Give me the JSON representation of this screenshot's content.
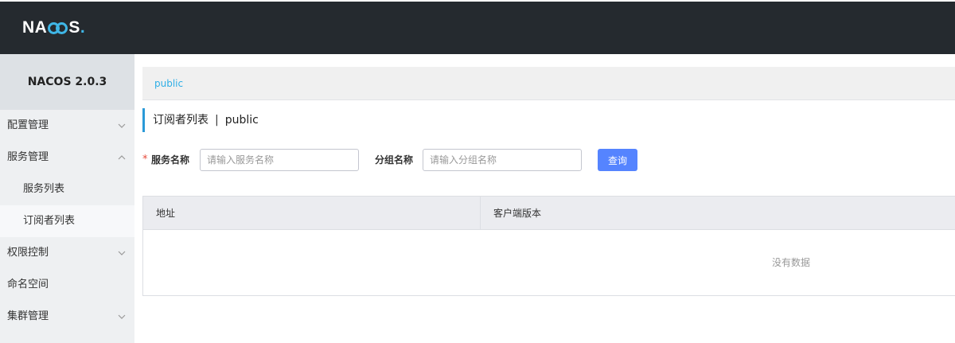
{
  "brand": {
    "logo_text_left": "NA",
    "logo_text_right": "S",
    "logo_dot": ".",
    "logo_full": "NACOS."
  },
  "sidebar": {
    "title": "NACOS 2.0.3",
    "items": [
      {
        "label": "配置管理",
        "expanded": false
      },
      {
        "label": "服务管理",
        "expanded": true
      },
      {
        "label": "服务列表",
        "sub": true
      },
      {
        "label": "订阅者列表",
        "sub": true,
        "active": true
      },
      {
        "label": "权限控制",
        "expanded": false
      },
      {
        "label": "命名空间"
      },
      {
        "label": "集群管理",
        "expanded": false
      }
    ]
  },
  "breadcrumb": {
    "namespace": "public"
  },
  "page": {
    "title": "订阅者列表",
    "separator": "|",
    "namespace": "public"
  },
  "search": {
    "required_mark": "*",
    "service_label": "服务名称",
    "service_placeholder": "请输入服务名称",
    "service_value": "",
    "group_label": "分组名称",
    "group_placeholder": "请输入分组名称",
    "group_value": "",
    "query_button": "查询"
  },
  "table": {
    "columns": [
      "地址",
      "客户端版本"
    ],
    "rows": [],
    "empty_text": "没有数据"
  },
  "colors": {
    "topbar": "#252a2f",
    "accent": "#2eaee6",
    "primary_button": "#5584ff",
    "required": "#e64a3b"
  }
}
